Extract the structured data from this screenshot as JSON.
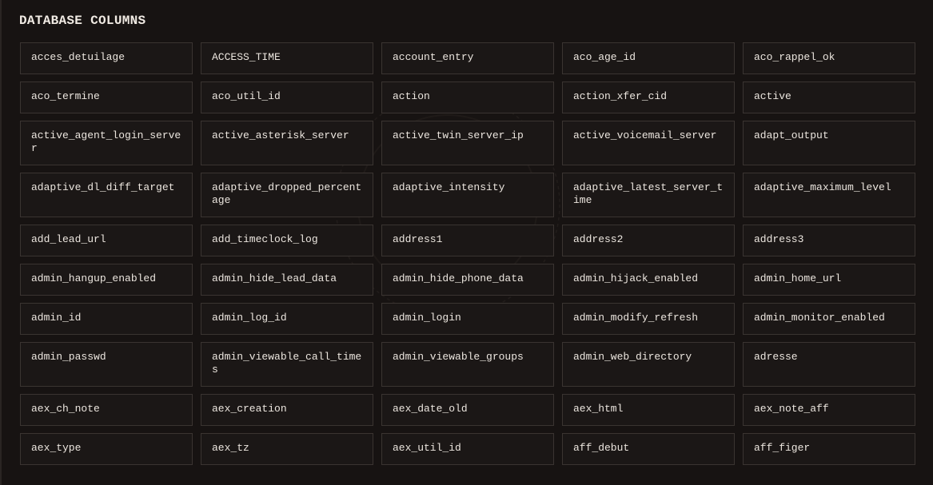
{
  "page": {
    "title": "DATABASE COLUMNS"
  },
  "rows": [
    [
      "acces_detuilage",
      "ACCESS_TIME",
      "account_entry",
      "aco_age_id",
      "aco_rappel_ok"
    ],
    [
      "aco_termine",
      "aco_util_id",
      "action",
      "action_xfer_cid",
      "active"
    ],
    [
      "active_agent_login_server",
      "active_asterisk_server",
      "active_twin_server_ip",
      "active_voicemail_server",
      "adapt_output"
    ],
    [
      "adaptive_dl_diff_target",
      "adaptive_dropped_percentage",
      "adaptive_intensity",
      "adaptive_latest_server_time",
      "adaptive_maximum_level"
    ],
    [
      "add_lead_url",
      "add_timeclock_log",
      "address1",
      "address2",
      "address3"
    ],
    [
      "admin_hangup_enabled",
      "admin_hide_lead_data",
      "admin_hide_phone_data",
      "admin_hijack_enabled",
      "admin_home_url"
    ],
    [
      "admin_id",
      "admin_log_id",
      "admin_login",
      "admin_modify_refresh",
      "admin_monitor_enabled"
    ],
    [
      "admin_passwd",
      "admin_viewable_call_times",
      "admin_viewable_groups",
      "admin_web_directory",
      "adresse"
    ],
    [
      "aex_ch_note",
      "aex_creation",
      "aex_date_old",
      "aex_html",
      "aex_note_aff"
    ],
    [
      "aex_type",
      "aex_tz",
      "aex_util_id",
      "aff_debut",
      "aff_figer"
    ]
  ]
}
